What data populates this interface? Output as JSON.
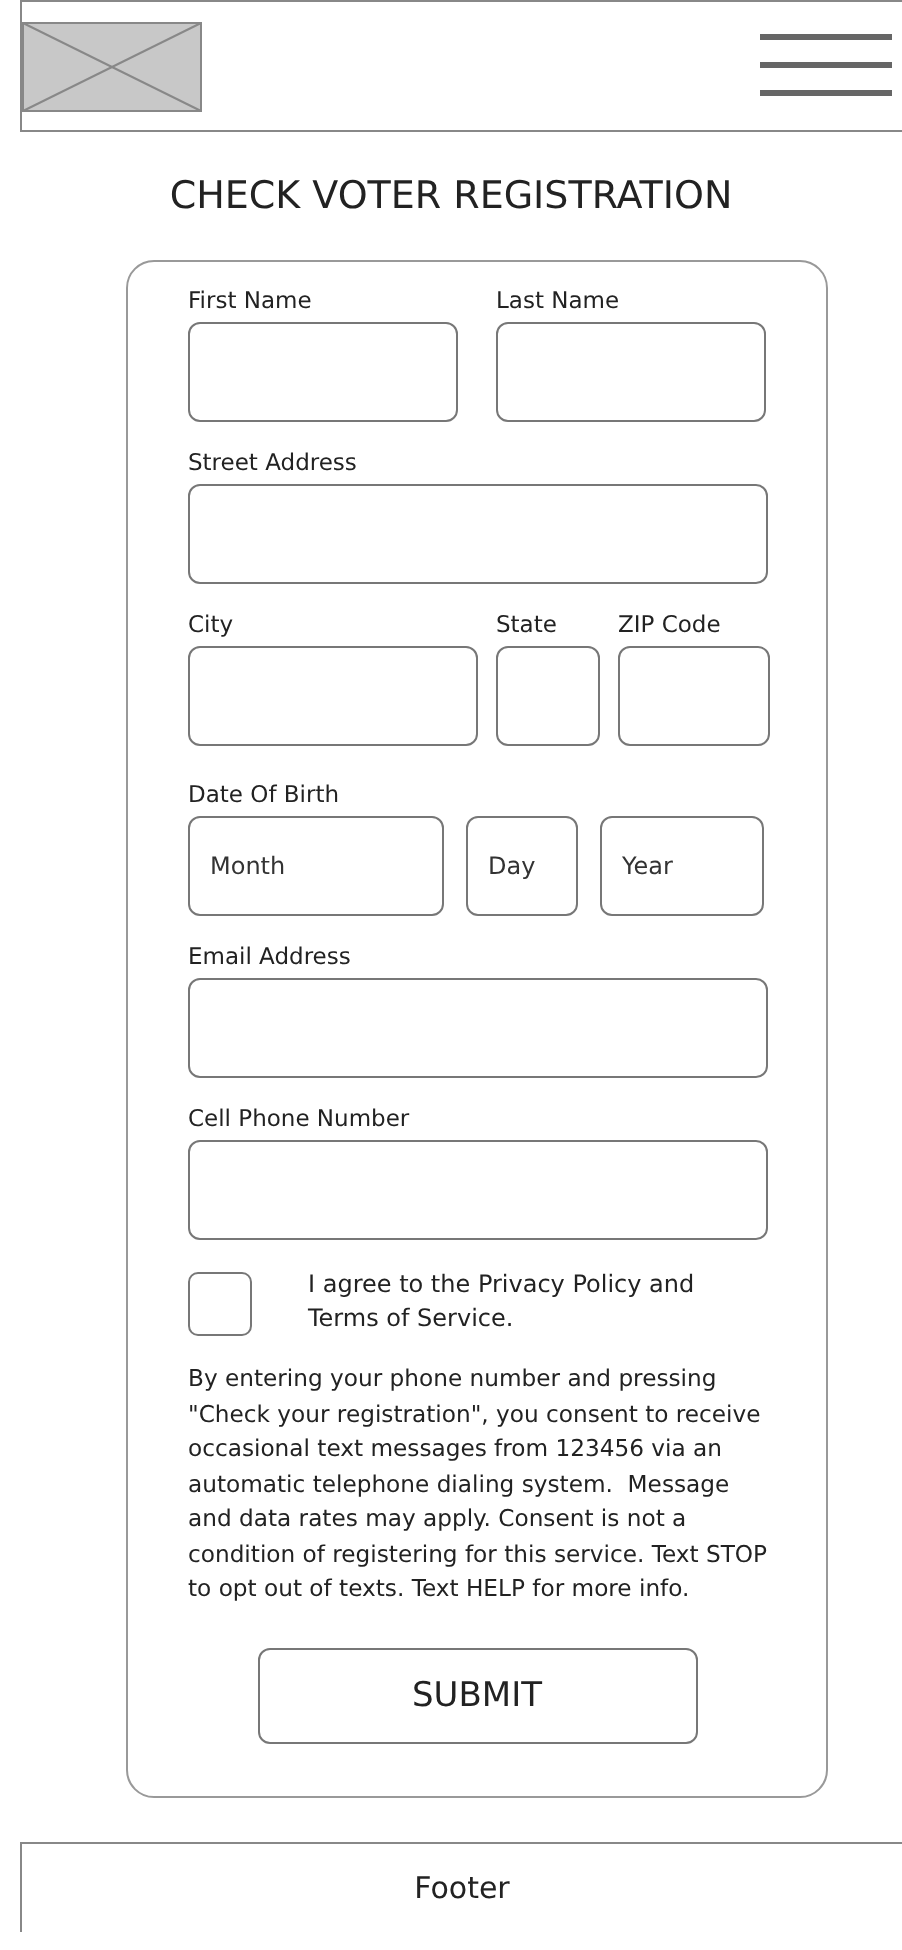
{
  "title": "CHECK VOTER REGISTRATION",
  "form": {
    "rows": [
      {
        "kind": "pair",
        "fields": [
          {
            "label": "First Name"
          },
          {
            "label": "Last Name"
          }
        ]
      },
      {
        "kind": "single",
        "fields": [
          {
            "label": "Street Address"
          }
        ]
      },
      {
        "kind": "address",
        "fields": [
          {
            "label": "City"
          },
          {
            "label": "State"
          },
          {
            "label": "ZIP Code"
          }
        ]
      },
      {
        "kind": "date",
        "label": "Date Of Birth",
        "fields": [
          {
            "placeholder": "Month"
          },
          {
            "placeholder": "Day"
          },
          {
            "placeholder": "Year"
          }
        ]
      },
      {
        "kind": "single",
        "fields": [
          {
            "label": "Email Address"
          }
        ]
      },
      {
        "kind": "single",
        "fields": [
          {
            "label": "Cell Phone Number"
          }
        ]
      }
    ],
    "agree": {
      "checked": false,
      "label": "I agree to the Privacy Policy and Terms of Service."
    },
    "consent": "By entering your phone number and pressing \"Check your registration\", you consent to receive occasional text messages from 123456 via an automatic telephone dialing system.  Message and data rates may apply. Consent is not a condition of registering for this service. Text STOP to opt out of texts. Text HELP for more info.",
    "submit": "SUBMIT"
  },
  "footer": "Footer"
}
